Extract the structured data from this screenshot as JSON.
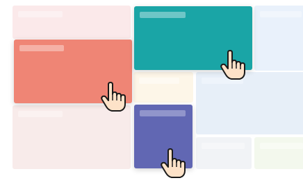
{
  "tiles": [
    {
      "name": "tile-top-left",
      "color": "#fbe9ea",
      "bar": "#fcf1f2"
    },
    {
      "name": "tile-top-teal",
      "color": "#1aa5a6",
      "bar": "#6ec6c7"
    },
    {
      "name": "tile-top-right",
      "color": "#e9f1fb",
      "bar": "#f1f6fc"
    },
    {
      "name": "tile-salmon",
      "color": "#ef8575",
      "bar": "#f5b1a6"
    },
    {
      "name": "tile-cream",
      "color": "#fdf6e8",
      "bar": "#fefaf2"
    },
    {
      "name": "tile-mid-blue",
      "color": "#e7eff8",
      "bar": "#eef4fb"
    },
    {
      "name": "tile-bottom-left",
      "color": "#f8ebea",
      "bar": "#fbf2f1"
    },
    {
      "name": "tile-purple",
      "color": "#6167b3",
      "bar": "#9195cb"
    },
    {
      "name": "tile-gray",
      "color": "#f1f3f6",
      "bar": "#f6f7f9"
    },
    {
      "name": "tile-green",
      "color": "#f3f8ed",
      "bar": "#f8fbf4"
    }
  ],
  "cursors": [
    {
      "name": "hand-cursor-icon-teal"
    },
    {
      "name": "hand-cursor-icon-salmon"
    },
    {
      "name": "hand-cursor-icon-purple"
    }
  ]
}
